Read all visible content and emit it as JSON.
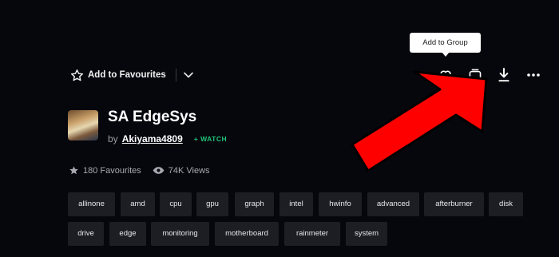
{
  "tooltip": {
    "text": "Add to Group"
  },
  "header": {
    "add_favourites_label": "Add to Favourites",
    "actions": [
      "heart-icon",
      "group-icon",
      "download-icon",
      "more-icon"
    ]
  },
  "item": {
    "title": "SA EdgeSys",
    "by_label": "by",
    "author": "Akiyama4809",
    "watch_label": "+ WATCH"
  },
  "stats": {
    "favourites": "180 Favourites",
    "views": "74K Views"
  },
  "tags": [
    "allinone",
    "amd",
    "cpu",
    "gpu",
    "graph",
    "intel",
    "hwinfo",
    "advanced",
    "afterburner",
    "disk",
    "drive",
    "edge",
    "monitoring",
    "motherboard",
    "rainmeter",
    "system"
  ],
  "colors": {
    "background": "#06070d",
    "tag_background": "#1c1e24",
    "watch_accent": "#21c47a",
    "annotation_arrow": "#ff0000"
  }
}
